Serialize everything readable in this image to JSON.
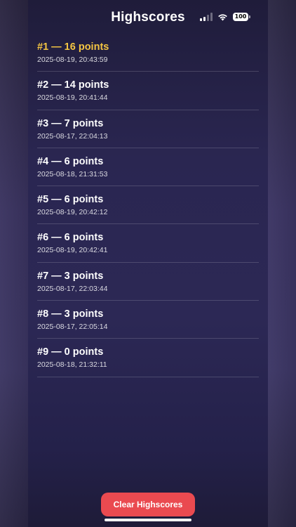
{
  "header": {
    "title": "Highscores"
  },
  "status_bar": {
    "battery": "100",
    "icons": [
      "cellular-signal-icon",
      "wifi-icon",
      "battery-icon"
    ]
  },
  "highscores": [
    {
      "label": "#1 — 16 points",
      "date": "2025-08-19, 20:43:59"
    },
    {
      "label": "#2 — 14 points",
      "date": "2025-08-19, 20:41:44"
    },
    {
      "label": "#3 — 7 points",
      "date": "2025-08-17, 22:04:13"
    },
    {
      "label": "#4 — 6 points",
      "date": "2025-08-18, 21:31:53"
    },
    {
      "label": "#5 — 6 points",
      "date": "2025-08-19, 20:42:12"
    },
    {
      "label": "#6 — 6 points",
      "date": "2025-08-19, 20:42:41"
    },
    {
      "label": "#7 — 3 points",
      "date": "2025-08-17, 22:03:44"
    },
    {
      "label": "#8 — 3 points",
      "date": "2025-08-17, 22:05:14"
    },
    {
      "label": "#9 — 0 points",
      "date": "2025-08-18, 21:32:11"
    }
  ],
  "actions": {
    "clear_label": "Clear Highscores"
  },
  "colors": {
    "accent_gold": "#f4c542",
    "button_red": "#ea4a50",
    "background": "#2c2855"
  }
}
